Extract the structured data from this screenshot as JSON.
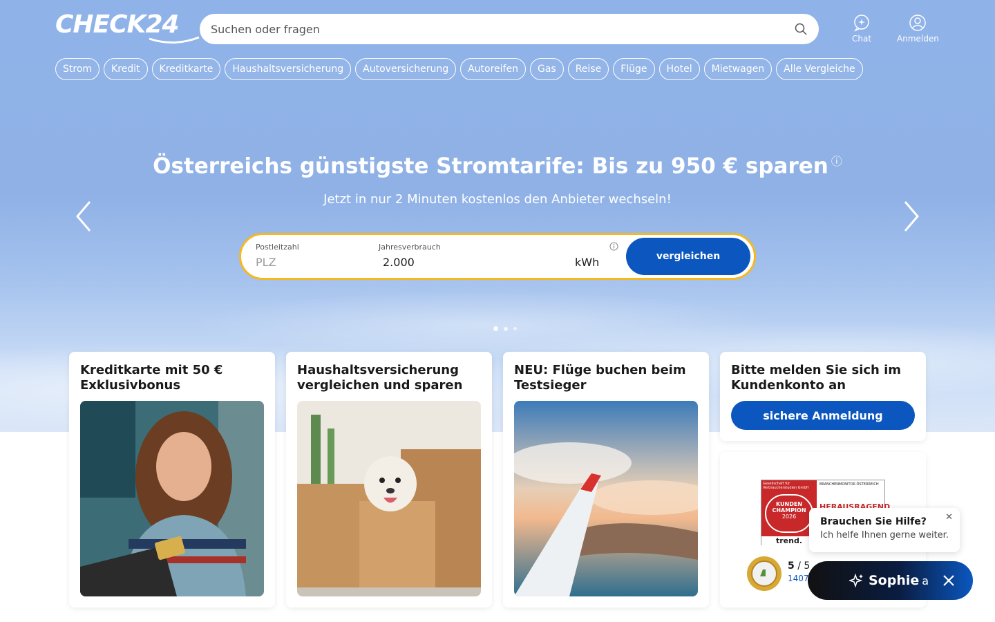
{
  "header": {
    "logo": "CHECK24",
    "search_placeholder": "Suchen oder fragen",
    "chat_label": "Chat",
    "login_label": "Anmelden"
  },
  "nav_pills": [
    "Strom",
    "Kredit",
    "Kreditkarte",
    "Haushaltsversicherung",
    "Autoversicherung",
    "Autoreifen",
    "Gas",
    "Reise",
    "Flüge",
    "Hotel",
    "Mietwagen",
    "Alle Vergleiche"
  ],
  "hero": {
    "title": "Österreichs günstigste Stromtarife: Bis zu 950 € sparen",
    "info_icon": "ⓘ",
    "subtitle": "Jetzt in nur 2 Minuten kostenlos den Anbieter wechseln!"
  },
  "form": {
    "plz_label": "Postleitzahl",
    "plz_placeholder": "PLZ",
    "usage_label": "Jahresverbrauch",
    "usage_value": "2.000",
    "usage_unit": "kWh",
    "submit_label": "vergleichen"
  },
  "cards": [
    {
      "title": "Kreditkarte mit 50 € Exklusivbonus"
    },
    {
      "title": "Haushaltsversicherung vergleichen und sparen"
    },
    {
      "title": "NEU: Flüge buchen beim Testsieger"
    },
    {
      "title": "Bitte melden Sie sich im Kundenkonto an",
      "button": "sichere Anmeldung"
    }
  ],
  "award": {
    "rating_bold": "5",
    "rating_rest": " / 5",
    "count": "1407",
    "badge_top": "Gesellschaft für Verbraucherstudien GmbH",
    "badge_line1": "KUNDEN",
    "badge_line2": "CHAMPION",
    "badge_year": "2026",
    "badge_brand": "trend.",
    "badge_right_top": "BRANCHENMONITOR ÖSTERREICH",
    "badge_right_text": "HERAUSRAGEND"
  },
  "help": {
    "title": "Brauchen Sie Hilfe?",
    "text": "Ich helfe Ihnen gerne weiter.",
    "close": "✕"
  },
  "sophie": {
    "name": "Sophie",
    "suffix": "a"
  }
}
